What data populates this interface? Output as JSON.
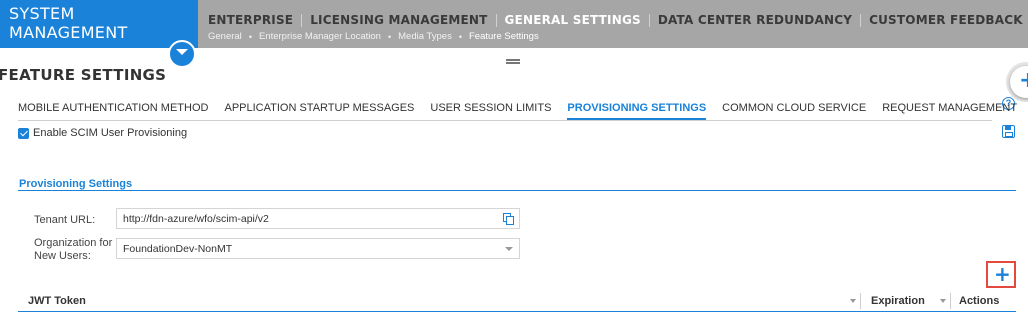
{
  "header": {
    "brand_line1": "SYSTEM",
    "brand_line2": "MANAGEMENT",
    "nav": [
      "ENTERPRISE",
      "LICENSING MANAGEMENT",
      "GENERAL SETTINGS",
      "DATA CENTER REDUNDANCY",
      "CUSTOMER FEEDBACK"
    ],
    "subnav": [
      "General",
      "Enterprise Manager Location",
      "Media Types",
      "Feature Settings"
    ]
  },
  "page": {
    "title": "FEATURE SETTINGS"
  },
  "tabs": [
    "MOBILE AUTHENTICATION METHOD",
    "APPLICATION STARTUP MESSAGES",
    "USER SESSION LIMITS",
    "PROVISIONING SETTINGS",
    "COMMON CLOUD SERVICE",
    "REQUEST MANAGEMENT"
  ],
  "scim": {
    "label": "Enable SCIM User Provisioning",
    "checked": true
  },
  "section": {
    "title": "Provisioning Settings"
  },
  "form": {
    "tenant_url_label": "Tenant URL:",
    "tenant_url_value": "http://fdn-azure/wfo/scim-api/v2",
    "org_label_line1": "Organization for",
    "org_label_line2": "New Users:",
    "org_value": "FoundationDev-NonMT"
  },
  "table": {
    "columns": [
      "JWT Token",
      "Expiration",
      "Actions"
    ]
  },
  "colors": {
    "accent": "#1a82d8",
    "header_gray": "#a6a6a6",
    "highlight_red": "#e24a3e"
  },
  "icons": {
    "fab": "plus-icon",
    "help": "help-icon",
    "save": "save-icon",
    "copy": "copy-icon",
    "add": "plus-icon"
  }
}
